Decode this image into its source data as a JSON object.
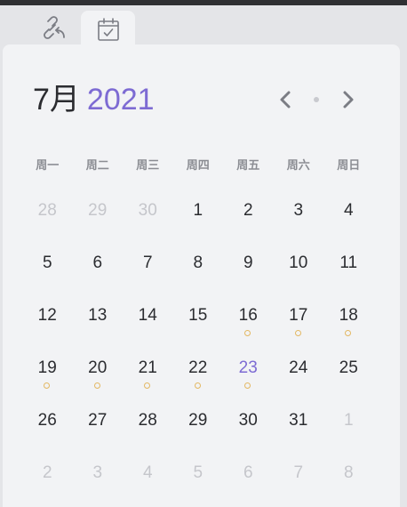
{
  "colors": {
    "accent": "#7d6bd3",
    "text": "#2b2c30",
    "muted": "#c5c6cb",
    "dot": "#e3b863"
  },
  "tabs": [
    {
      "icon": "link-back-icon"
    },
    {
      "icon": "calendar-check-icon",
      "active": true
    }
  ],
  "header": {
    "month": "7月",
    "year": "2021"
  },
  "weekdays": [
    "周一",
    "周二",
    "周三",
    "周四",
    "周五",
    "周六",
    "周日"
  ],
  "weeks": [
    [
      {
        "d": "28",
        "other": true
      },
      {
        "d": "29",
        "other": true
      },
      {
        "d": "30",
        "other": true
      },
      {
        "d": "1"
      },
      {
        "d": "2"
      },
      {
        "d": "3"
      },
      {
        "d": "4"
      }
    ],
    [
      {
        "d": "5"
      },
      {
        "d": "6"
      },
      {
        "d": "7"
      },
      {
        "d": "8"
      },
      {
        "d": "9"
      },
      {
        "d": "10"
      },
      {
        "d": "11"
      }
    ],
    [
      {
        "d": "12"
      },
      {
        "d": "13"
      },
      {
        "d": "14"
      },
      {
        "d": "15"
      },
      {
        "d": "16",
        "dot": true
      },
      {
        "d": "17",
        "dot": true
      },
      {
        "d": "18",
        "dot": true
      }
    ],
    [
      {
        "d": "19",
        "dot": true
      },
      {
        "d": "20",
        "dot": true
      },
      {
        "d": "21",
        "dot": true
      },
      {
        "d": "22",
        "dot": true
      },
      {
        "d": "23",
        "dot": true,
        "today": true
      },
      {
        "d": "24"
      },
      {
        "d": "25"
      }
    ],
    [
      {
        "d": "26"
      },
      {
        "d": "27"
      },
      {
        "d": "28"
      },
      {
        "d": "29"
      },
      {
        "d": "30"
      },
      {
        "d": "31"
      },
      {
        "d": "1",
        "other": true
      }
    ],
    [
      {
        "d": "2",
        "other": true
      },
      {
        "d": "3",
        "other": true
      },
      {
        "d": "4",
        "other": true
      },
      {
        "d": "5",
        "other": true
      },
      {
        "d": "6",
        "other": true
      },
      {
        "d": "7",
        "other": true
      },
      {
        "d": "8",
        "other": true
      }
    ]
  ]
}
